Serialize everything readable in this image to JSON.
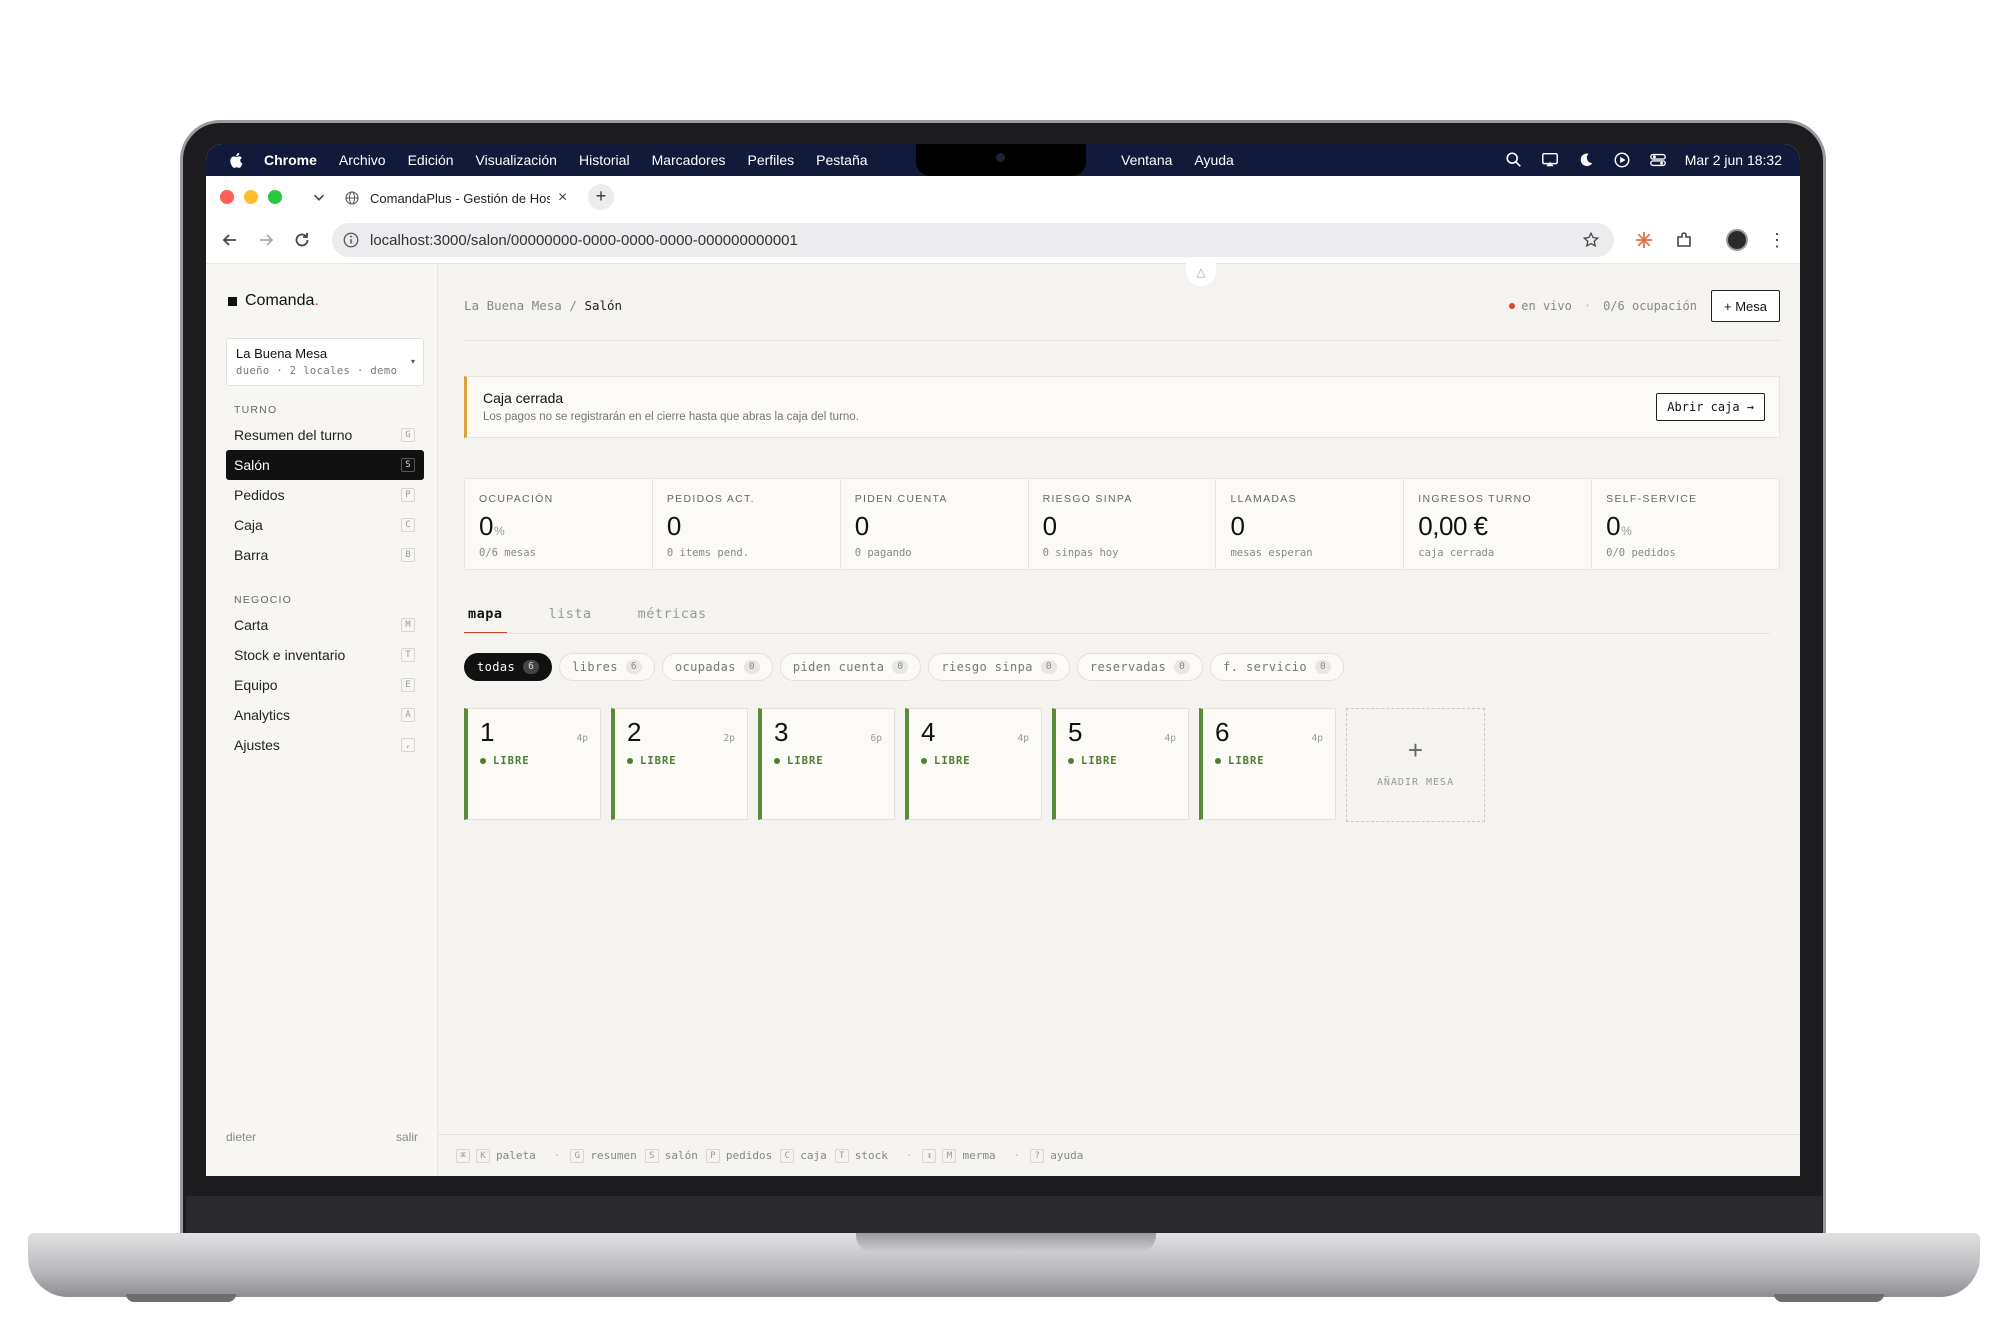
{
  "menubar": {
    "app": "Chrome",
    "items": [
      "Archivo",
      "Edición",
      "Visualización",
      "Historial",
      "Marcadores",
      "Perfiles",
      "Pestaña"
    ],
    "items_right": [
      "Ventana",
      "Ayuda"
    ],
    "clock": "Mar 2 jun 18:32"
  },
  "browser": {
    "tab_title": "ComandaPlus - Gestión de Hostelería",
    "url": "localhost:3000/salon/00000000-0000-0000-0000-000000000001"
  },
  "sidebar": {
    "brand": "Comanda",
    "brand_accent": ".",
    "venue": {
      "name": "La Buena Mesa",
      "meta": "dueño · 2 locales · demo"
    },
    "section_turno": "TURNO",
    "turno_items": [
      {
        "label": "Resumen del turno",
        "key": "G"
      },
      {
        "label": "Salón",
        "key": "S"
      },
      {
        "label": "Pedidos",
        "key": "P"
      },
      {
        "label": "Caja",
        "key": "C"
      },
      {
        "label": "Barra",
        "key": "B"
      }
    ],
    "section_negocio": "NEGOCIO",
    "negocio_items": [
      {
        "label": "Carta",
        "key": "M"
      },
      {
        "label": "Stock e inventario",
        "key": "T"
      },
      {
        "label": "Equipo",
        "key": "E"
      },
      {
        "label": "Analytics",
        "key": "A"
      },
      {
        "label": "Ajustes",
        "key": ","
      }
    ],
    "user": "dieter",
    "logout": "salir"
  },
  "header": {
    "crumb_root": "La Buena Mesa",
    "crumb_sep": "/",
    "crumb_current": "Salón",
    "live": "en vivo",
    "occupancy": "0/6 ocupación",
    "add_table_button": "+ Mesa"
  },
  "alert": {
    "title": "Caja cerrada",
    "text": "Los pagos no se registrarán en el cierre hasta que abras la caja del turno.",
    "button": "Abrir caja →"
  },
  "kpis": [
    {
      "label": "OCUPACIÓN",
      "value": "0",
      "unit": "%",
      "sub": "0/6 mesas"
    },
    {
      "label": "PEDIDOS ACT.",
      "value": "0",
      "unit": "",
      "sub": "0 items pend."
    },
    {
      "label": "PIDEN CUENTA",
      "value": "0",
      "unit": "",
      "sub": "0 pagando"
    },
    {
      "label": "RIESGO SINPA",
      "value": "0",
      "unit": "",
      "sub": "0 sinpas hoy"
    },
    {
      "label": "LLAMADAS",
      "value": "0",
      "unit": "",
      "sub": "mesas esperan"
    },
    {
      "label": "INGRESOS TURNO",
      "value": "0,00 €",
      "unit": "",
      "sub": "caja cerrada"
    },
    {
      "label": "SELF-SERVICE",
      "value": "0",
      "unit": "%",
      "sub": "0/0 pedidos"
    }
  ],
  "view_tabs": [
    "mapa",
    "lista",
    "métricas"
  ],
  "filters": [
    {
      "label": "todas",
      "count": "6"
    },
    {
      "label": "libres",
      "count": "6"
    },
    {
      "label": "ocupadas",
      "count": "0"
    },
    {
      "label": "piden cuenta",
      "count": "0"
    },
    {
      "label": "riesgo sinpa",
      "count": "0"
    },
    {
      "label": "reservadas",
      "count": "0"
    },
    {
      "label": "f. servicio",
      "count": "0"
    }
  ],
  "tables": [
    {
      "number": "1",
      "capacity": "4p",
      "status": "LIBRE"
    },
    {
      "number": "2",
      "capacity": "2p",
      "status": "LIBRE"
    },
    {
      "number": "3",
      "capacity": "6p",
      "status": "LIBRE"
    },
    {
      "number": "4",
      "capacity": "4p",
      "status": "LIBRE"
    },
    {
      "number": "5",
      "capacity": "4p",
      "status": "LIBRE"
    },
    {
      "number": "6",
      "capacity": "4p",
      "status": "LIBRE"
    }
  ],
  "add_table": {
    "plus": "+",
    "label": "AÑADIR MESA"
  },
  "shortcuts": [
    {
      "keys": [
        "⌘",
        "K"
      ],
      "label": "paleta"
    },
    {
      "keys": [
        "G"
      ],
      "label": "resumen"
    },
    {
      "keys": [
        "S"
      ],
      "label": "salón"
    },
    {
      "keys": [
        "P"
      ],
      "label": "pedidos"
    },
    {
      "keys": [
        "C"
      ],
      "label": "caja"
    },
    {
      "keys": [
        "T"
      ],
      "label": "stock"
    },
    {
      "keys": [
        "↕",
        "M"
      ],
      "label": "merma"
    },
    {
      "keys": [
        "?"
      ],
      "label": "ayuda"
    }
  ],
  "colors": {
    "accent": "#c04828",
    "free_status": "#4f7d2f",
    "alert_border": "#e0a03a",
    "live_dot": "#d64a2c"
  }
}
